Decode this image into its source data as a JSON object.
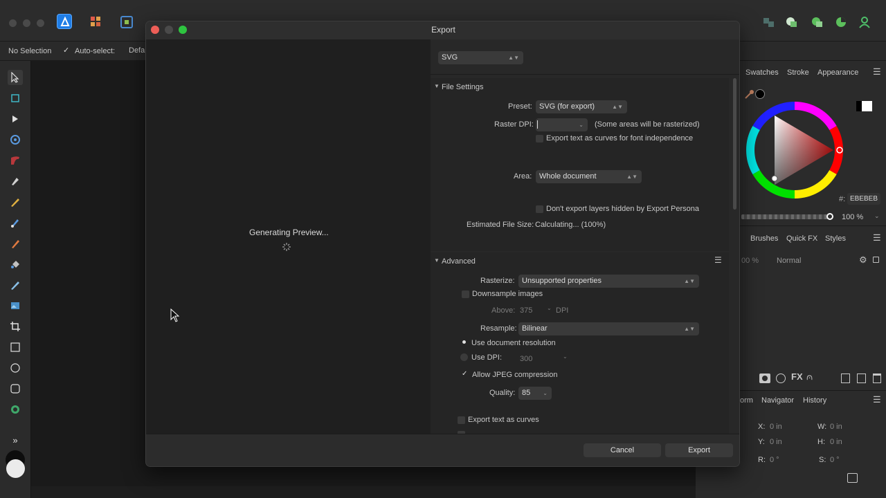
{
  "app": {
    "context": {
      "selection": "No Selection",
      "autoselect": "Auto-select:",
      "default": "Defa"
    },
    "panels": {
      "color_tabs": [
        "Swatches",
        "Stroke",
        "Appearance"
      ],
      "hex_label": "#:",
      "hex_value": "EBEBEB",
      "opacity": "100 %",
      "brush_tabs": [
        "Brushes",
        "Quick FX",
        "Styles"
      ],
      "layer_opacity": "00 %",
      "blend_mode": "Normal",
      "transform_tabs": [
        "orm",
        "Navigator",
        "History"
      ],
      "x_label": "X:",
      "x_value": "0 in",
      "w_label": "W:",
      "w_value": "0 in",
      "y_label": "Y:",
      "y_value": "0 in",
      "h_label": "H:",
      "h_value": "0 in",
      "r_label": "R:",
      "r_value": "0 °",
      "s_label": "S:",
      "s_value": "0 °"
    }
  },
  "dialog": {
    "title": "Export",
    "preview_status": "Generating Preview...",
    "format": "SVG",
    "file_settings": {
      "header": "File Settings",
      "preset_label": "Preset:",
      "preset_value": "SVG (for export)",
      "raster_dpi_label": "Raster DPI:",
      "raster_dpi_value": "",
      "raster_note": "(Some areas will be rasterized)",
      "text_curves_label": "Export text as curves for font independence",
      "area_label": "Area:",
      "area_value": "Whole document",
      "hidden_layers_label": "Don't export layers hidden by Export Persona",
      "size_label": "Estimated File Size:",
      "size_value": "Calculating... (100%)"
    },
    "advanced": {
      "header": "Advanced",
      "rasterize_label": "Rasterize:",
      "rasterize_value": "Unsupported properties",
      "downsample_label": "Downsample images",
      "above_label": "Above:",
      "above_value": "375",
      "dpi_unit": "DPI",
      "resample_label": "Resample:",
      "resample_value": "Bilinear",
      "use_doc_res_label": "Use document resolution",
      "use_dpi_label": "Use DPI:",
      "use_dpi_value": "300",
      "jpeg_label": "Allow JPEG compression",
      "quality_label": "Quality:",
      "quality_value": "85",
      "text_curves_label": "Export text as curves"
    },
    "cancel_label": "Cancel",
    "export_label": "Export"
  }
}
